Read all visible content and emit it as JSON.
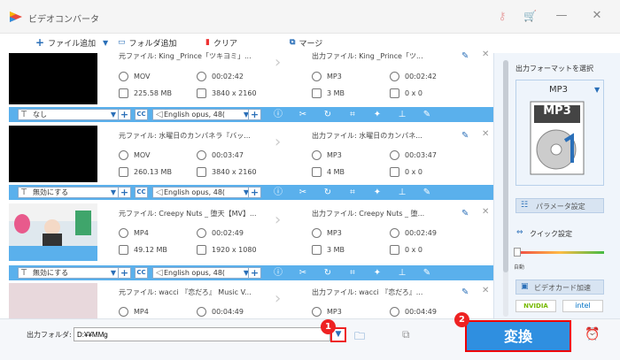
{
  "window": {
    "title": "ビデオコンバータ"
  },
  "toolbar": {
    "add_file": "ファイル追加",
    "add_folder": "フォルダ追加",
    "clear": "クリア",
    "merge": "マージ"
  },
  "rows": [
    {
      "src_name": "元ファイル: King _Prince「ツキヨミ」...",
      "src_format": "MOV",
      "src_duration": "00:02:42",
      "src_size": "225.58 MB",
      "src_res": "3840 x 2160",
      "out_name": "出力ファイル: King _Prince「ツ...",
      "out_format": "MP3",
      "out_duration": "00:02:42",
      "out_size": "3 MB",
      "out_res": "0 x 0",
      "subtitle": "なし",
      "audio": "English opus, 48("
    },
    {
      "src_name": "元ファイル: 水曜日のカンパネラ『バッ...",
      "src_format": "MOV",
      "src_duration": "00:03:47",
      "src_size": "260.13 MB",
      "src_res": "3840 x 2160",
      "out_name": "出力ファイル: 水曜日のカンパネ...",
      "out_format": "MP3",
      "out_duration": "00:03:47",
      "out_size": "4 MB",
      "out_res": "0 x 0",
      "subtitle": "無効にする",
      "audio": "English opus, 48("
    },
    {
      "src_name": "元ファイル: Creepy Nuts _ 堕天【MV】...",
      "src_format": "MP4",
      "src_duration": "00:02:49",
      "src_size": "49.12 MB",
      "src_res": "1920 x 1080",
      "out_name": "出力ファイル: Creepy Nuts _ 堕...",
      "out_format": "MP3",
      "out_duration": "00:02:49",
      "out_size": "3 MB",
      "out_res": "0 x 0",
      "subtitle": "無効にする",
      "audio": "English opus, 48("
    },
    {
      "src_name": "元ファイル: wacci 『恋だろ』 Music V...",
      "src_format": "MP4",
      "src_duration": "00:04:49",
      "src_size": "",
      "src_res": "",
      "out_name": "出力ファイル: wacci 『恋だろ』...",
      "out_format": "MP3",
      "out_duration": "00:04:49",
      "out_size": "",
      "out_res": "",
      "subtitle": "",
      "audio": ""
    }
  ],
  "sidebar": {
    "select_format": "出力フォーマットを選択",
    "format": "MP3",
    "format_icon_label": "MP3",
    "params": "パラメータ設定",
    "quick": "クイック設定",
    "auto": "自動",
    "gpu": "ビデオカード加速",
    "nvidia": "NVIDIA",
    "intel": "intel"
  },
  "bottom": {
    "folder_label": "出力フォルダ:",
    "path": "D:¥¥MMg",
    "convert": "変換",
    "badge1": "1",
    "badge2": "2"
  },
  "colors": {
    "accent": "#5ab0ec",
    "convert": "#2f8fe0",
    "badge": "#e22222"
  }
}
